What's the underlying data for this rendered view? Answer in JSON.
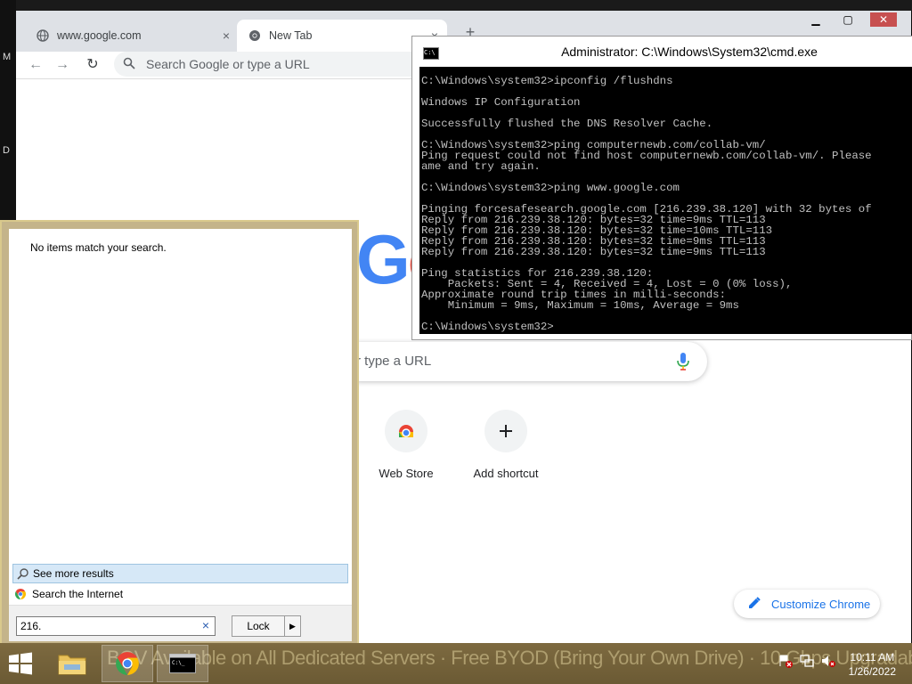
{
  "desktop": {
    "left_chars": [
      "M",
      "D"
    ]
  },
  "chrome": {
    "tabs": [
      {
        "title": "www.google.com",
        "close": "×",
        "icon": "globe-icon"
      },
      {
        "title": "New Tab",
        "close": "×",
        "icon": "chrome-icon"
      }
    ],
    "new_tab": "+",
    "window_buttons": {
      "minimize": "▁",
      "maximize": "▢",
      "close": "✕"
    },
    "nav": {
      "back": "←",
      "forward": "→",
      "reload": "↻"
    },
    "omnibox_placeholder": "Search Google or type a URL",
    "search_box_placeholder": "r type a URL",
    "shortcuts": [
      {
        "label": "Web Store",
        "icon": "webstore-icon"
      },
      {
        "label": "Add shortcut",
        "icon": "plus-icon"
      }
    ],
    "customize_label": "Customize Chrome",
    "colors": {
      "accent": "#1a73e8",
      "tabstrip": "#dee1e6"
    }
  },
  "cmd": {
    "title": "Administrator: C:\\Windows\\System32\\cmd.exe",
    "lines": [
      "C:\\Windows\\system32>ipconfig /flushdns",
      "",
      "Windows IP Configuration",
      "",
      "Successfully flushed the DNS Resolver Cache.",
      "",
      "C:\\Windows\\system32>ping computernewb.com/collab-vm/",
      "Ping request could not find host computernewb.com/collab-vm/. Please",
      "ame and try again.",
      "",
      "C:\\Windows\\system32>ping www.google.com",
      "",
      "Pinging forcesafesearch.google.com [216.239.38.120] with 32 bytes of",
      "Reply from 216.239.38.120: bytes=32 time=9ms TTL=113",
      "Reply from 216.239.38.120: bytes=32 time=10ms TTL=113",
      "Reply from 216.239.38.120: bytes=32 time=9ms TTL=113",
      "Reply from 216.239.38.120: bytes=32 time=9ms TTL=113",
      "",
      "Ping statistics for 216.239.38.120:",
      "    Packets: Sent = 4, Received = 4, Lost = 0 (0% loss),",
      "Approximate round trip times in milli-seconds:",
      "    Minimum = 9ms, Maximum = 10ms, Average = 9ms",
      "",
      "C:\\Windows\\system32>"
    ]
  },
  "start_search": {
    "no_items": "No items match your search.",
    "see_more": "See more results",
    "search_internet": "Search the Internet",
    "query": "216.",
    "clear": "×",
    "lock_label": "Lock",
    "lock_arrow": "▶"
  },
  "taskbar": {
    "banner": "BGV Available on All Dedicated Servers · Free BYOD (Bring Your Own Drive) · 10 Gbps Upgradable",
    "items": [
      {
        "name": "file-explorer",
        "icon": "folder-icon"
      },
      {
        "name": "chrome",
        "icon": "chrome-icon"
      },
      {
        "name": "cmd",
        "icon": "cmd-icon"
      }
    ],
    "clock_time": "10:11 AM",
    "clock_date": "1/26/2022"
  }
}
